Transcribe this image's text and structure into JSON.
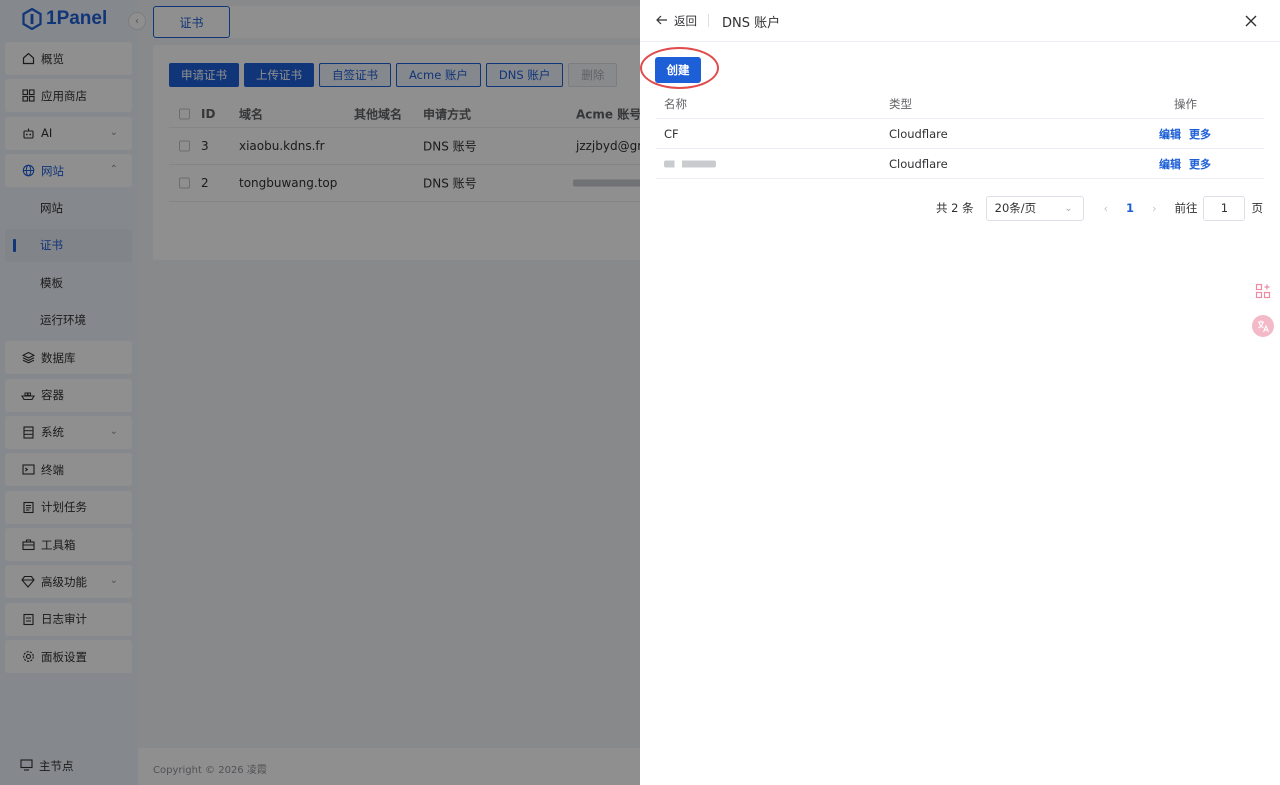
{
  "app": {
    "logo_text": "1Panel"
  },
  "sidebar": {
    "items": [
      {
        "label": "概览",
        "icon": "home-icon",
        "type": "top"
      },
      {
        "label": "应用商店",
        "icon": "grid-icon",
        "type": "top"
      },
      {
        "label": "AI",
        "icon": "robot-icon",
        "type": "top",
        "chevron": "down"
      },
      {
        "label": "网站",
        "icon": "globe-icon",
        "type": "top",
        "chevron": "up"
      },
      {
        "label": "网站",
        "type": "sub"
      },
      {
        "label": "证书",
        "type": "sub",
        "active": true
      },
      {
        "label": "模板",
        "type": "sub"
      },
      {
        "label": "运行环境",
        "type": "sub"
      },
      {
        "label": "数据库",
        "icon": "layers-icon",
        "type": "top"
      },
      {
        "label": "容器",
        "icon": "ship-icon",
        "type": "top"
      },
      {
        "label": "系统",
        "icon": "system-icon",
        "type": "top",
        "chevron": "down"
      },
      {
        "label": "终端",
        "icon": "terminal-icon",
        "type": "top"
      },
      {
        "label": "计划任务",
        "icon": "schedule-icon",
        "type": "top"
      },
      {
        "label": "工具箱",
        "icon": "toolbox-icon",
        "type": "top"
      },
      {
        "label": "高级功能",
        "icon": "diamond-icon",
        "type": "top",
        "chevron": "down"
      },
      {
        "label": "日志审计",
        "icon": "log-icon",
        "type": "top"
      },
      {
        "label": "面板设置",
        "icon": "gear-icon",
        "type": "top"
      }
    ],
    "node_label": "主节点"
  },
  "main": {
    "tab_label": "证书",
    "buttons": {
      "apply": "申请证书",
      "upload": "上传证书",
      "self_signed": "自签证书",
      "acme": "Acme 账户",
      "dns": "DNS 账户",
      "delete": "删除"
    },
    "cert_table": {
      "headers": {
        "id": "ID",
        "domain": "域名",
        "other": "其他域名",
        "method": "申请方式",
        "acme": "Acme 账号"
      },
      "rows": [
        {
          "id": "3",
          "domain": "xiaobu.kdns.fr",
          "method": "DNS 账号",
          "acme": "jzzjbyd@gma"
        },
        {
          "id": "2",
          "domain": "tongbuwang.top",
          "method": "DNS 账号",
          "acme": ""
        }
      ]
    },
    "footer": "Copyright © 2026 凌霞"
  },
  "drawer": {
    "back_label": "返回",
    "title": "DNS 账户",
    "create_label": "创建",
    "table": {
      "headers": {
        "name": "名称",
        "type": "类型",
        "ops": "操作"
      },
      "rows": [
        {
          "name": "CF",
          "type": "Cloudflare",
          "edit": "编辑",
          "more": "更多"
        },
        {
          "name": "",
          "type": "Cloudflare",
          "edit": "编辑",
          "more": "更多"
        }
      ]
    },
    "pagination": {
      "total": "共 2 条",
      "page_size": "20条/页",
      "current": "1",
      "goto_label": "前往",
      "goto_value": "1",
      "page_suffix": "页"
    }
  },
  "colors": {
    "accent": "#1d5fd6",
    "highlight": "#e04b4b"
  }
}
